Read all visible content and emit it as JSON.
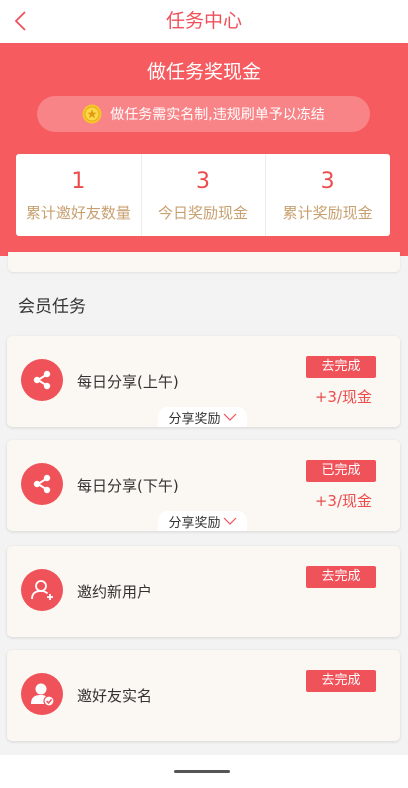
{
  "navbar": {
    "title": "任务中心",
    "back_icon": "chevron-left-icon"
  },
  "hero": {
    "title": "做任务奖现金",
    "notice": "做任务需实名制,违规刷单予以冻结",
    "notice_icon": "gold-coin-icon"
  },
  "stats": [
    {
      "value": "1",
      "label": "累计邀好友数量"
    },
    {
      "value": "3",
      "label": "今日奖励现金"
    },
    {
      "value": "3",
      "label": "累计奖励现金"
    }
  ],
  "section": {
    "title": "会员任务"
  },
  "tasks": [
    {
      "name": "每日分享(上午)",
      "button": "去完成",
      "reward": "+3/现金",
      "toggle": "分享奖励",
      "icon": "share-icon"
    },
    {
      "name": "每日分享(下午)",
      "button": "已完成",
      "reward": "+3/现金",
      "toggle": "分享奖励",
      "icon": "share-icon"
    },
    {
      "name": "邀约新用户",
      "button": "去完成",
      "icon": "add-user-icon"
    },
    {
      "name": "邀好友实名",
      "button": "去完成",
      "icon": "verified-user-icon"
    }
  ],
  "colors": {
    "primary": "#f65b5f",
    "accent_red": "#f0525a",
    "gold_text": "#c8a070",
    "card_bg": "#fbf7f2"
  }
}
